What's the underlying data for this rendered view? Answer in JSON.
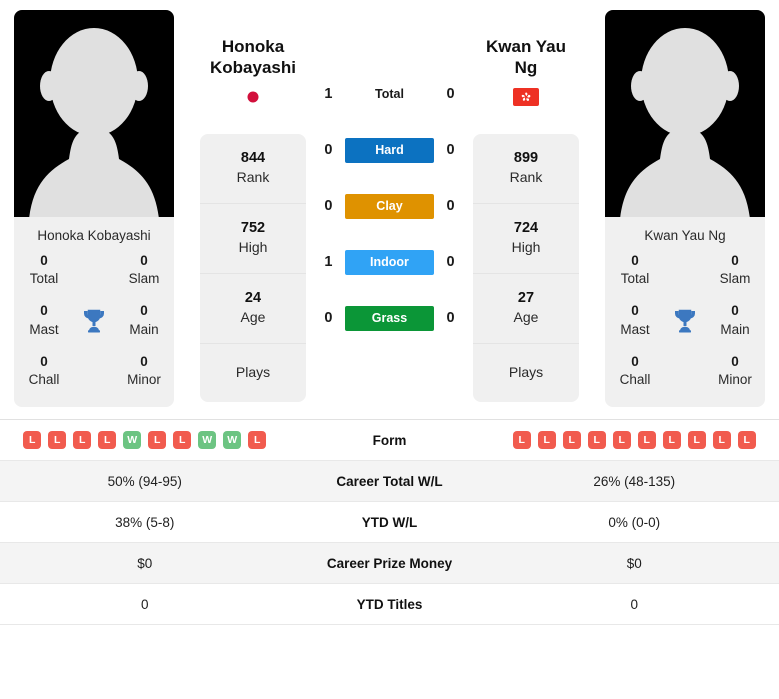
{
  "players": {
    "left": {
      "name": "Honoka Kobayashi",
      "name_line1": "Honoka",
      "name_line2": "Kobayashi",
      "country_flag": "japan-flag",
      "rank": "844",
      "rank_label": "Rank",
      "high": "752",
      "high_label": "High",
      "age": "24",
      "age_label": "Age",
      "plays": "Plays",
      "titles": {
        "total": "0",
        "total_label": "Total",
        "slam": "0",
        "slam_label": "Slam",
        "mast": "0",
        "mast_label": "Mast",
        "main": "0",
        "main_label": "Main",
        "chall": "0",
        "chall_label": "Chall",
        "minor": "0",
        "minor_label": "Minor"
      },
      "form": [
        "L",
        "L",
        "L",
        "L",
        "W",
        "L",
        "L",
        "W",
        "W",
        "L"
      ],
      "career_total_wl": "50% (94-95)",
      "ytd_wl": "38% (5-8)",
      "career_prize_money": "$0",
      "ytd_titles": "0"
    },
    "right": {
      "name": "Kwan Yau Ng",
      "name_line1": "Kwan Yau Ng",
      "name_line2": "",
      "country_flag": "hong-kong-flag",
      "rank": "899",
      "rank_label": "Rank",
      "high": "724",
      "high_label": "High",
      "age": "27",
      "age_label": "Age",
      "plays": "Plays",
      "titles": {
        "total": "0",
        "total_label": "Total",
        "slam": "0",
        "slam_label": "Slam",
        "mast": "0",
        "mast_label": "Mast",
        "main": "0",
        "main_label": "Main",
        "chall": "0",
        "chall_label": "Chall",
        "minor": "0",
        "minor_label": "Minor"
      },
      "form": [
        "L",
        "L",
        "L",
        "L",
        "L",
        "L",
        "L",
        "L",
        "L",
        "L"
      ],
      "career_total_wl": "26% (48-135)",
      "ytd_wl": "0% (0-0)",
      "career_prize_money": "$0",
      "ytd_titles": "0"
    }
  },
  "h2h": [
    {
      "label": "Total",
      "left": "1",
      "right": "0",
      "color": "",
      "type": "total"
    },
    {
      "label": "Hard",
      "left": "0",
      "right": "0",
      "color": "#0c72c1",
      "type": "surface"
    },
    {
      "label": "Clay",
      "left": "0",
      "right": "0",
      "color": "#df9200",
      "type": "surface"
    },
    {
      "label": "Indoor",
      "left": "1",
      "right": "0",
      "color": "#30a3f5",
      "type": "surface"
    },
    {
      "label": "Grass",
      "left": "0",
      "right": "0",
      "color": "#0b9637",
      "type": "surface"
    }
  ],
  "stats_rows": [
    {
      "label": "Form"
    },
    {
      "label": "Career Total W/L",
      "left": "50% (94-95)",
      "right": "26% (48-135)"
    },
    {
      "label": "YTD W/L",
      "left": "38% (5-8)",
      "right": "0% (0-0)"
    },
    {
      "label": "Career Prize Money",
      "left": "$0",
      "right": "$0"
    },
    {
      "label": "YTD Titles",
      "left": "0",
      "right": "0"
    }
  ],
  "colors": {
    "hard": "#0c72c1",
    "clay": "#df9200",
    "indoor": "#30a3f5",
    "grass": "#0b9637",
    "win_badge": "#6cc482",
    "loss_badge": "#f15b4e",
    "trophy": "#3c78c0",
    "card_bg": "#f0f0f0"
  }
}
